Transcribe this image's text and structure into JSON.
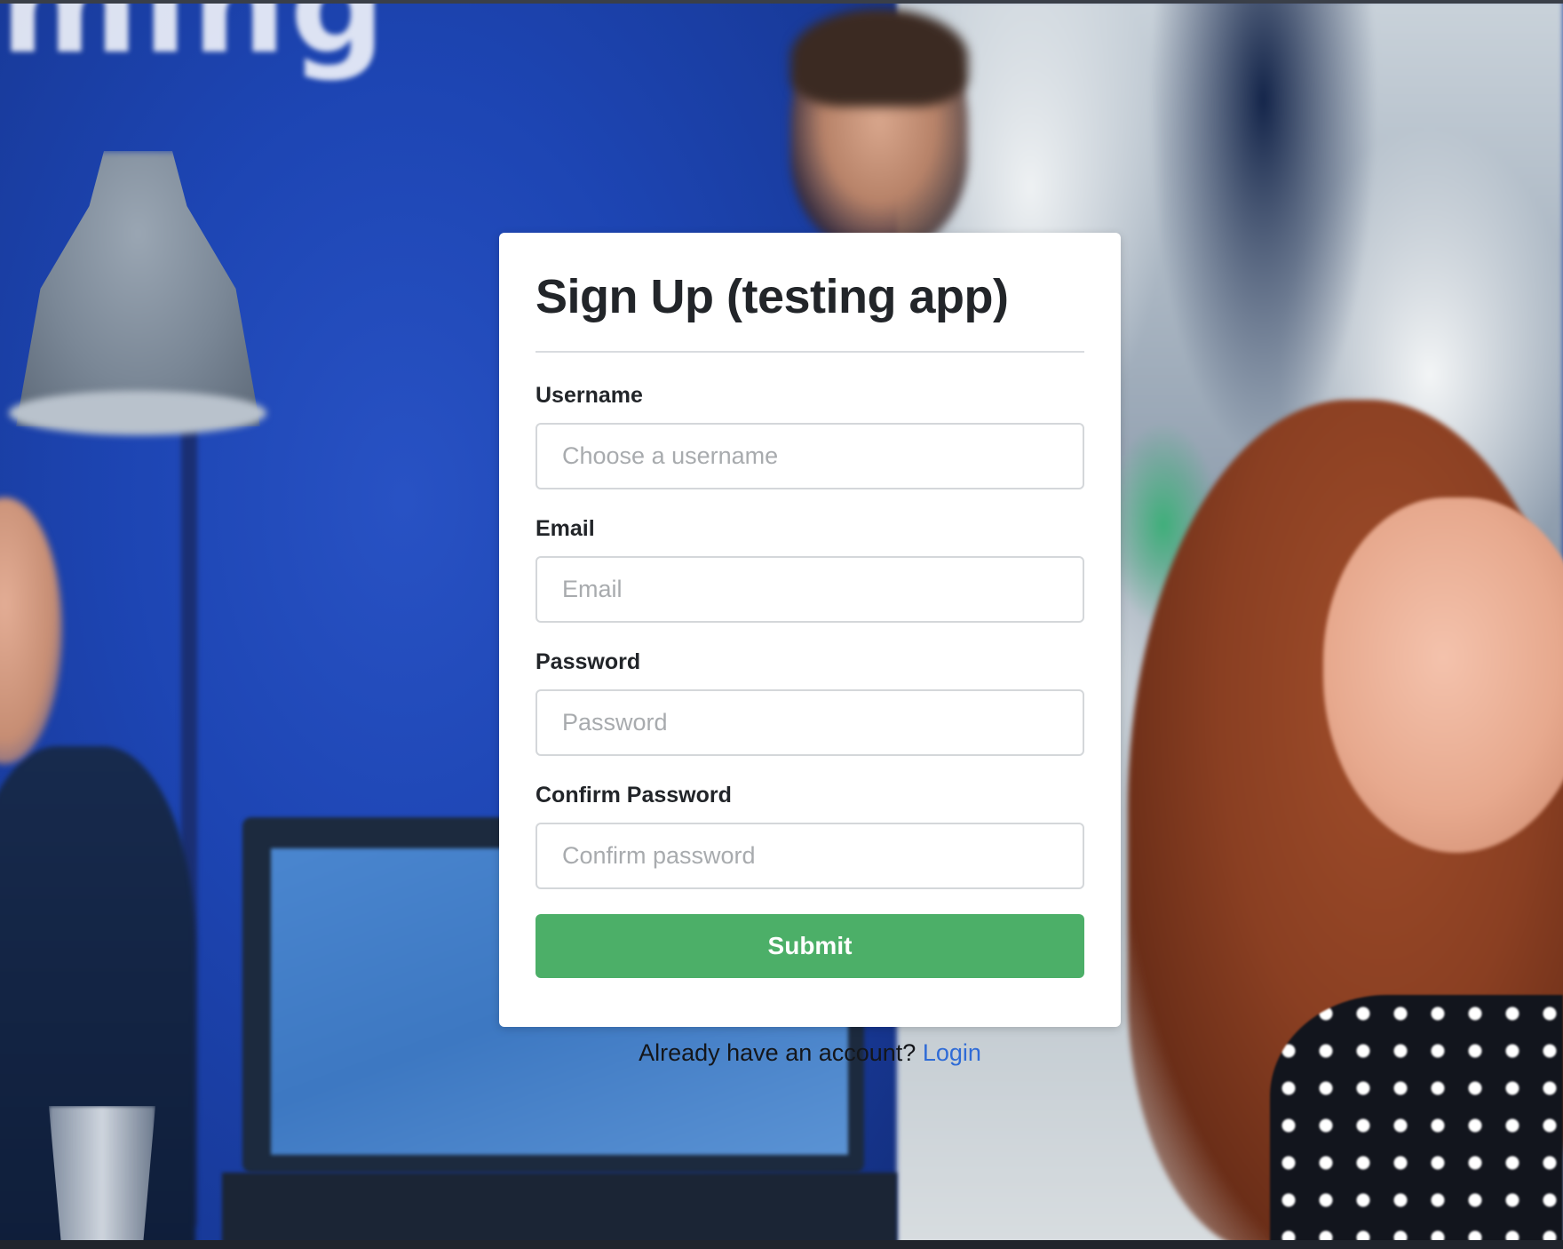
{
  "background": {
    "wall_sign_text": "ming"
  },
  "form": {
    "title": "Sign Up (testing app)",
    "fields": [
      {
        "label": "Username",
        "placeholder": "Choose a username",
        "value": ""
      },
      {
        "label": "Email",
        "placeholder": "Email",
        "value": ""
      },
      {
        "label": "Password",
        "placeholder": "Password",
        "value": ""
      },
      {
        "label": "Confirm Password",
        "placeholder": "Confirm password",
        "value": ""
      }
    ],
    "submit_label": "Submit"
  },
  "footer": {
    "prompt": "Already have an account?",
    "login_link": "Login"
  },
  "colors": {
    "accent_green": "#4caf68",
    "link_blue": "#2f6bd6",
    "text_dark": "#222529"
  }
}
